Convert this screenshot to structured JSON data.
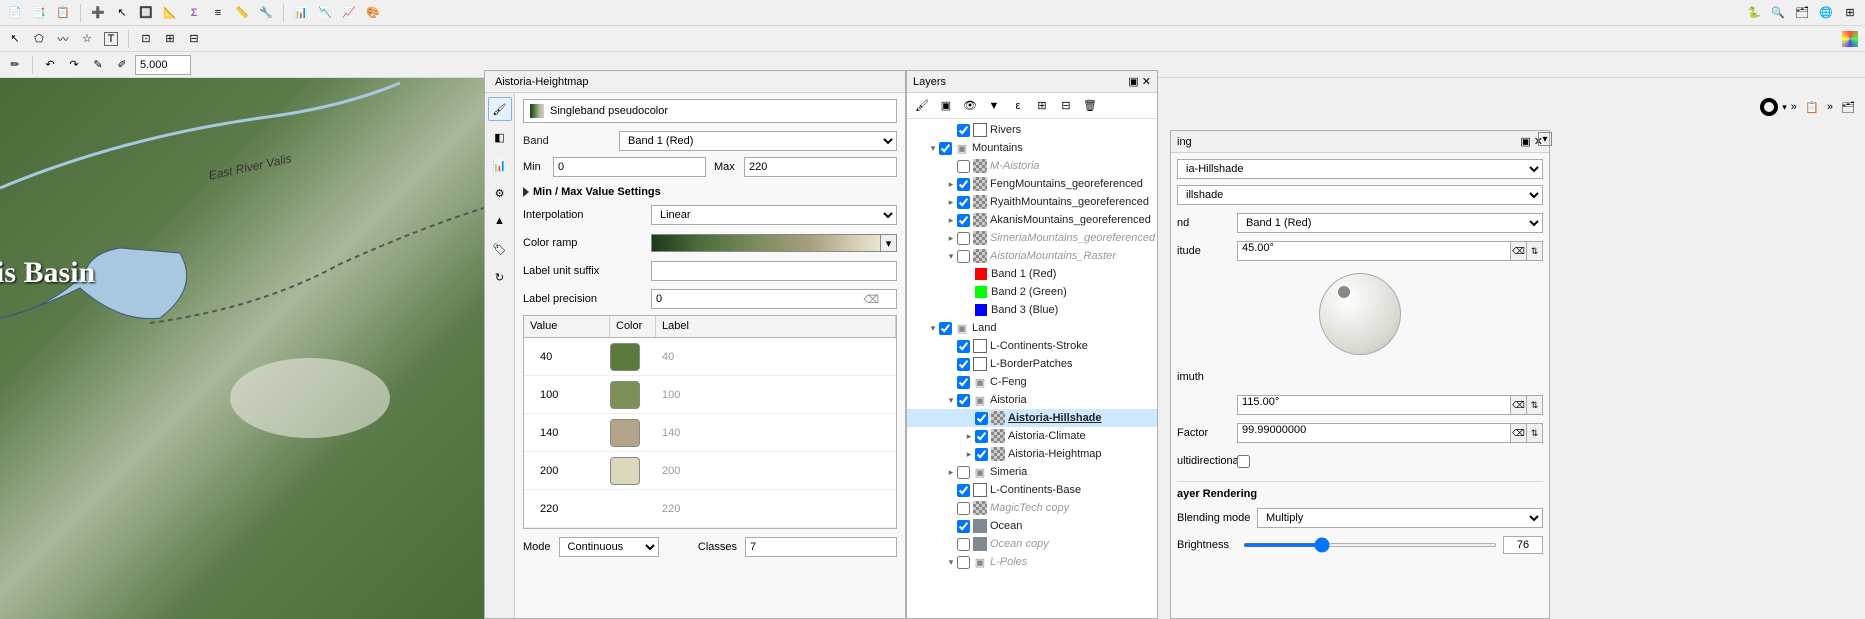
{
  "toolbars": {
    "spin_value": "5.000"
  },
  "map": {
    "basin_label": "is Basin",
    "river_label": "East River Valis"
  },
  "heightmap_panel": {
    "title": "Aistoria-Heightmap",
    "render_type": "Singleband pseudocolor",
    "band_label": "Band",
    "band_value": "Band 1 (Red)",
    "min_label": "Min",
    "min_value": "0",
    "max_label": "Max",
    "max_value": "220",
    "minmax_settings": "Min / Max Value Settings",
    "interp_label": "Interpolation",
    "interp_value": "Linear",
    "ramp_label": "Color ramp",
    "suffix_label": "Label unit suffix",
    "suffix_value": "",
    "precision_label": "Label precision",
    "precision_value": "0",
    "table_headers": {
      "value": "Value",
      "color": "Color",
      "label": "Label"
    },
    "rows": [
      {
        "value": "40",
        "color": "#5a7a3c",
        "label": "40"
      },
      {
        "value": "100",
        "color": "#7b9158",
        "label": "100"
      },
      {
        "value": "140",
        "color": "#b3a48a",
        "label": "140"
      },
      {
        "value": "200",
        "color": "#dcd8be",
        "label": "200"
      },
      {
        "value": "220",
        "color": "",
        "label": "220"
      }
    ],
    "mode_label": "Mode",
    "mode_value": "Continuous",
    "classes_label": "Classes",
    "classes_value": "7"
  },
  "layers_panel": {
    "title": "Layers",
    "tree": [
      {
        "indent": 2,
        "exp": "",
        "checked": true,
        "icon": "vector",
        "name": "Rivers",
        "style": ""
      },
      {
        "indent": 1,
        "exp": "▾",
        "checked": true,
        "icon": "group",
        "name": "Mountains",
        "style": ""
      },
      {
        "indent": 2,
        "exp": "",
        "checked": false,
        "icon": "raster",
        "name": "M-Aistoria",
        "style": "disabled"
      },
      {
        "indent": 2,
        "exp": "▸",
        "checked": true,
        "icon": "raster",
        "name": "FengMountains_georeferenced",
        "style": ""
      },
      {
        "indent": 2,
        "exp": "▸",
        "checked": true,
        "icon": "raster",
        "name": "RyaithMountains_georeferenced",
        "style": ""
      },
      {
        "indent": 2,
        "exp": "▸",
        "checked": true,
        "icon": "raster",
        "name": "AkanisMountains_georeferenced",
        "style": ""
      },
      {
        "indent": 2,
        "exp": "▸",
        "checked": false,
        "icon": "raster",
        "name": "SimeriaMountains_georeferenced",
        "style": "disabled"
      },
      {
        "indent": 2,
        "exp": "▾",
        "checked": false,
        "icon": "raster",
        "name": "AistoriaMountains_Raster",
        "style": "disabled"
      },
      {
        "indent": 3,
        "exp": "",
        "checked": null,
        "swatch": "#ff0000",
        "name": "Band 1 (Red)",
        "style": ""
      },
      {
        "indent": 3,
        "exp": "",
        "checked": null,
        "swatch": "#00ff00",
        "name": "Band 2 (Green)",
        "style": ""
      },
      {
        "indent": 3,
        "exp": "",
        "checked": null,
        "swatch": "#0000ff",
        "name": "Band 3 (Blue)",
        "style": ""
      },
      {
        "indent": 1,
        "exp": "▾",
        "checked": true,
        "icon": "group",
        "name": "Land",
        "style": ""
      },
      {
        "indent": 2,
        "exp": "",
        "checked": true,
        "icon": "vector",
        "name": "L-Continents-Stroke",
        "style": ""
      },
      {
        "indent": 2,
        "exp": "",
        "checked": true,
        "icon": "vector",
        "name": "L-BorderPatches",
        "style": ""
      },
      {
        "indent": 2,
        "exp": "",
        "checked": true,
        "icon": "group",
        "name": "C-Feng",
        "style": ""
      },
      {
        "indent": 2,
        "exp": "▾",
        "checked": true,
        "icon": "group",
        "name": "Aistoria",
        "style": ""
      },
      {
        "indent": 3,
        "exp": "",
        "checked": true,
        "icon": "raster",
        "name": "Aistoria-Hillshade",
        "style": "sel bold"
      },
      {
        "indent": 3,
        "exp": "▸",
        "checked": true,
        "icon": "raster",
        "name": "Aistoria-Climate",
        "style": ""
      },
      {
        "indent": 3,
        "exp": "▸",
        "checked": true,
        "icon": "raster",
        "name": "Aistoria-Heightmap",
        "style": ""
      },
      {
        "indent": 2,
        "exp": "▸",
        "checked": false,
        "icon": "group",
        "name": "Simeria",
        "style": ""
      },
      {
        "indent": 2,
        "exp": "",
        "checked": true,
        "icon": "vector",
        "name": "L-Continents-Base",
        "style": ""
      },
      {
        "indent": 2,
        "exp": "",
        "checked": false,
        "icon": "raster",
        "name": "MagicTech copy",
        "style": "disabled"
      },
      {
        "indent": 2,
        "exp": "",
        "checked": true,
        "icon": "ocean",
        "name": "Ocean",
        "style": ""
      },
      {
        "indent": 2,
        "exp": "",
        "checked": false,
        "icon": "ocean",
        "name": "Ocean copy",
        "style": "disabled"
      },
      {
        "indent": 2,
        "exp": "▾",
        "checked": false,
        "icon": "group",
        "name": "L-Poles",
        "style": "disabled"
      }
    ]
  },
  "props_panel": {
    "ing_suffix": "ing",
    "layer_sel": "ia-Hillshade",
    "type_sel": "illshade",
    "band_label_frag": "nd",
    "band_value": "Band 1 (Red)",
    "altitude_label_frag": "itude",
    "altitude_value": "45.00°",
    "azimuth_label_frag": "imuth",
    "azimuth_value": "115.00°",
    "zfactor_label_frag": "Factor",
    "zfactor_value": "99.99000000",
    "multidir_label_frag": "ultidirectional",
    "section_render": "ayer Rendering",
    "blend_label": "Blending mode",
    "blend_value": "Multiply",
    "bright_label": "Brightness",
    "bright_value": "76"
  }
}
